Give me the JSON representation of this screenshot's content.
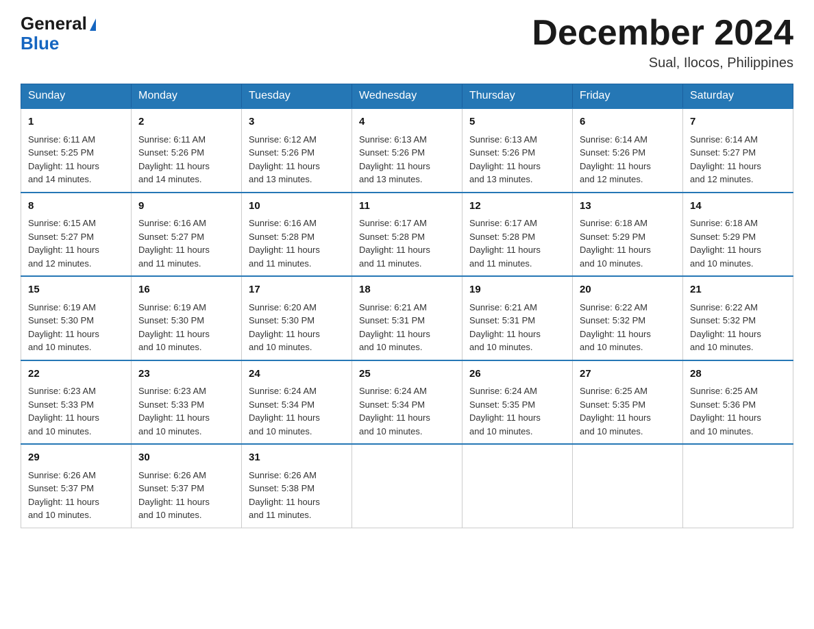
{
  "logo": {
    "general": "General",
    "blue": "Blue",
    "triangle": "▶"
  },
  "header": {
    "month": "December 2024",
    "location": "Sual, Ilocos, Philippines"
  },
  "weekdays": [
    "Sunday",
    "Monday",
    "Tuesday",
    "Wednesday",
    "Thursday",
    "Friday",
    "Saturday"
  ],
  "weeks": [
    [
      {
        "day": 1,
        "sunrise": "6:11 AM",
        "sunset": "5:25 PM",
        "daylight": "11 hours and 14 minutes."
      },
      {
        "day": 2,
        "sunrise": "6:11 AM",
        "sunset": "5:26 PM",
        "daylight": "11 hours and 14 minutes."
      },
      {
        "day": 3,
        "sunrise": "6:12 AM",
        "sunset": "5:26 PM",
        "daylight": "11 hours and 13 minutes."
      },
      {
        "day": 4,
        "sunrise": "6:13 AM",
        "sunset": "5:26 PM",
        "daylight": "11 hours and 13 minutes."
      },
      {
        "day": 5,
        "sunrise": "6:13 AM",
        "sunset": "5:26 PM",
        "daylight": "11 hours and 13 minutes."
      },
      {
        "day": 6,
        "sunrise": "6:14 AM",
        "sunset": "5:26 PM",
        "daylight": "11 hours and 12 minutes."
      },
      {
        "day": 7,
        "sunrise": "6:14 AM",
        "sunset": "5:27 PM",
        "daylight": "11 hours and 12 minutes."
      }
    ],
    [
      {
        "day": 8,
        "sunrise": "6:15 AM",
        "sunset": "5:27 PM",
        "daylight": "11 hours and 12 minutes."
      },
      {
        "day": 9,
        "sunrise": "6:16 AM",
        "sunset": "5:27 PM",
        "daylight": "11 hours and 11 minutes."
      },
      {
        "day": 10,
        "sunrise": "6:16 AM",
        "sunset": "5:28 PM",
        "daylight": "11 hours and 11 minutes."
      },
      {
        "day": 11,
        "sunrise": "6:17 AM",
        "sunset": "5:28 PM",
        "daylight": "11 hours and 11 minutes."
      },
      {
        "day": 12,
        "sunrise": "6:17 AM",
        "sunset": "5:28 PM",
        "daylight": "11 hours and 11 minutes."
      },
      {
        "day": 13,
        "sunrise": "6:18 AM",
        "sunset": "5:29 PM",
        "daylight": "11 hours and 10 minutes."
      },
      {
        "day": 14,
        "sunrise": "6:18 AM",
        "sunset": "5:29 PM",
        "daylight": "11 hours and 10 minutes."
      }
    ],
    [
      {
        "day": 15,
        "sunrise": "6:19 AM",
        "sunset": "5:30 PM",
        "daylight": "11 hours and 10 minutes."
      },
      {
        "day": 16,
        "sunrise": "6:19 AM",
        "sunset": "5:30 PM",
        "daylight": "11 hours and 10 minutes."
      },
      {
        "day": 17,
        "sunrise": "6:20 AM",
        "sunset": "5:30 PM",
        "daylight": "11 hours and 10 minutes."
      },
      {
        "day": 18,
        "sunrise": "6:21 AM",
        "sunset": "5:31 PM",
        "daylight": "11 hours and 10 minutes."
      },
      {
        "day": 19,
        "sunrise": "6:21 AM",
        "sunset": "5:31 PM",
        "daylight": "11 hours and 10 minutes."
      },
      {
        "day": 20,
        "sunrise": "6:22 AM",
        "sunset": "5:32 PM",
        "daylight": "11 hours and 10 minutes."
      },
      {
        "day": 21,
        "sunrise": "6:22 AM",
        "sunset": "5:32 PM",
        "daylight": "11 hours and 10 minutes."
      }
    ],
    [
      {
        "day": 22,
        "sunrise": "6:23 AM",
        "sunset": "5:33 PM",
        "daylight": "11 hours and 10 minutes."
      },
      {
        "day": 23,
        "sunrise": "6:23 AM",
        "sunset": "5:33 PM",
        "daylight": "11 hours and 10 minutes."
      },
      {
        "day": 24,
        "sunrise": "6:24 AM",
        "sunset": "5:34 PM",
        "daylight": "11 hours and 10 minutes."
      },
      {
        "day": 25,
        "sunrise": "6:24 AM",
        "sunset": "5:34 PM",
        "daylight": "11 hours and 10 minutes."
      },
      {
        "day": 26,
        "sunrise": "6:24 AM",
        "sunset": "5:35 PM",
        "daylight": "11 hours and 10 minutes."
      },
      {
        "day": 27,
        "sunrise": "6:25 AM",
        "sunset": "5:35 PM",
        "daylight": "11 hours and 10 minutes."
      },
      {
        "day": 28,
        "sunrise": "6:25 AM",
        "sunset": "5:36 PM",
        "daylight": "11 hours and 10 minutes."
      }
    ],
    [
      {
        "day": 29,
        "sunrise": "6:26 AM",
        "sunset": "5:37 PM",
        "daylight": "11 hours and 10 minutes."
      },
      {
        "day": 30,
        "sunrise": "6:26 AM",
        "sunset": "5:37 PM",
        "daylight": "11 hours and 10 minutes."
      },
      {
        "day": 31,
        "sunrise": "6:26 AM",
        "sunset": "5:38 PM",
        "daylight": "11 hours and 11 minutes."
      },
      null,
      null,
      null,
      null
    ]
  ],
  "labels": {
    "sunrise": "Sunrise:",
    "sunset": "Sunset:",
    "daylight": "Daylight:"
  }
}
